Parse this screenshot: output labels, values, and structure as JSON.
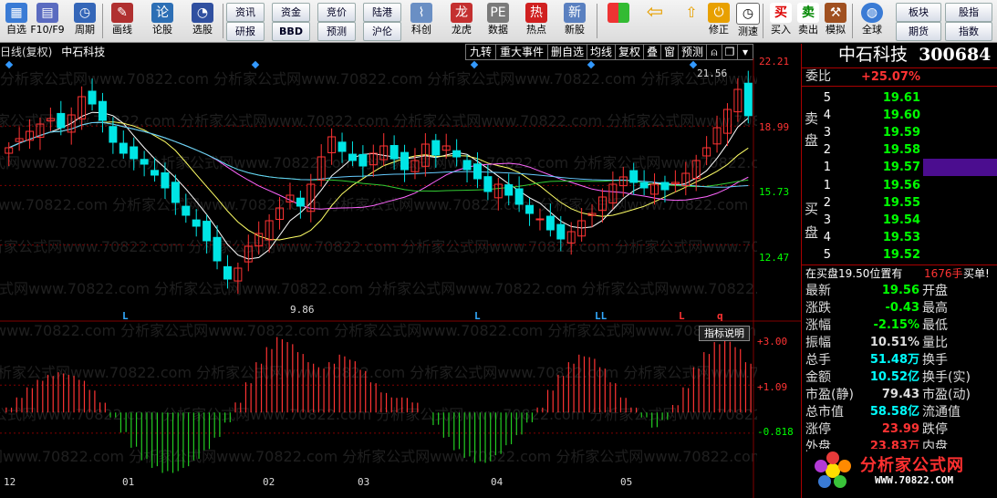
{
  "toolbar": {
    "groups": [
      {
        "label": "自选",
        "icon": "grid-icon",
        "color": "#3a7bd5"
      },
      {
        "label": "F10/F9",
        "icon": "doc-icon",
        "color": "#5a6bc0"
      },
      {
        "label": "周期",
        "icon": "clock-icon",
        "color": "#3466b8"
      },
      {
        "label": "画线",
        "icon": "pencil-icon",
        "color": "#b03030"
      },
      {
        "label": "论股",
        "icon": "chat-icon",
        "color": "#2d6fb5"
      },
      {
        "label": "选股",
        "icon": "gauge-icon",
        "color": "#3050a0"
      }
    ],
    "small_buttons_row1": [
      "资讯",
      "资金",
      "竞价",
      "陆港"
    ],
    "small_buttons_row2": [
      "研报",
      "BBD",
      "预测",
      "沪伦"
    ],
    "apps": [
      "科创",
      "龙虎",
      "数据",
      "热点",
      "新股"
    ],
    "right_buttons": [
      "修正",
      "测速",
      "买入",
      "卖出",
      "模拟",
      "全球"
    ],
    "right_small_row1": [
      "板块",
      "股指"
    ],
    "right_small_row2": [
      "期货",
      "指数"
    ]
  },
  "chart": {
    "title": "日线(复权)",
    "stock_name": "中石科技",
    "tabs": [
      "九转",
      "重大事件",
      "删自选",
      "均线",
      "复权",
      "叠",
      "窗",
      "预测"
    ],
    "price_ticks": [
      "22.21",
      "18.99",
      "15.73",
      "12.47"
    ],
    "high_marker": "21.56",
    "low_marker": "9.86",
    "indicator_button": "指标说明",
    "indicator_ticks": [
      "+3.00",
      "+1.09",
      "-0.818"
    ],
    "x_ticks": [
      "12",
      "01",
      "02",
      "03",
      "04",
      "05"
    ],
    "l_markers": [
      "L",
      "L",
      "LL",
      "L",
      "q"
    ]
  },
  "quote": {
    "name": "中石科技",
    "code": "300684",
    "weibi_label": "委比",
    "weibi_value": "+25.07%",
    "sell_label": [
      "卖",
      "盘"
    ],
    "buy_label": [
      "买",
      "盘"
    ],
    "asks": [
      {
        "level": "5",
        "price": "19.61"
      },
      {
        "level": "4",
        "price": "19.60"
      },
      {
        "level": "3",
        "price": "19.59"
      },
      {
        "level": "2",
        "price": "19.58"
      },
      {
        "level": "1",
        "price": "19.57"
      }
    ],
    "bids": [
      {
        "level": "1",
        "price": "19.56"
      },
      {
        "level": "2",
        "price": "19.55"
      },
      {
        "level": "3",
        "price": "19.54"
      },
      {
        "level": "4",
        "price": "19.53"
      },
      {
        "level": "5",
        "price": "19.52"
      }
    ],
    "notice_prefix": "在买盘19.50位置有",
    "notice_amount": "1676手",
    "notice_suffix": "买单!",
    "stats": [
      {
        "label": "最新",
        "value": "19.56",
        "label2": "开盘",
        "color": "#0f0"
      },
      {
        "label": "涨跌",
        "value": "-0.43",
        "label2": "最高",
        "color": "#0f0"
      },
      {
        "label": "涨幅",
        "value": "-2.15%",
        "label2": "最低",
        "color": "#0f0"
      },
      {
        "label": "振幅",
        "value": "10.51%",
        "label2": "量比",
        "color": "#ddd"
      },
      {
        "label": "总手",
        "value": "51.48万",
        "label2": "换手",
        "color": "#0ff"
      },
      {
        "label": "金额",
        "value": "10.52亿",
        "label2": "换手(实)",
        "color": "#0ff"
      },
      {
        "label": "市盈(静)",
        "value": "79.43",
        "label2": "市盈(动)",
        "color": "#ddd"
      },
      {
        "label": "总市值",
        "value": "58.58亿",
        "label2": "流通值",
        "color": "#0ff"
      },
      {
        "label": "涨停",
        "value": "23.99",
        "label2": "跌停",
        "color": "#f33"
      },
      {
        "label": "外盘",
        "value": "23.83万",
        "label2": "内盘",
        "color": "#f33"
      }
    ],
    "logo_text": "分析家公式网",
    "logo_url": "WWW.70822.COM"
  },
  "watermark": "分析家公式网www.70822.com",
  "colors": {
    "up": "#ff3333",
    "down": "#00e5e5",
    "grid": "#800000"
  },
  "chart_data": {
    "type": "line",
    "candles_close": [
      17.8,
      18.3,
      18.7,
      19.1,
      19.4,
      18.9,
      19.6,
      20.6,
      20.2,
      19.3,
      18.1,
      17.5,
      17.2,
      16.9,
      16.3,
      15.6,
      14.8,
      14.1,
      13.5,
      12.7,
      11.6,
      10.6,
      11.2,
      12.4,
      13.1,
      13.8,
      14.5,
      15.2,
      14.6,
      15.8,
      17.3,
      18.4,
      17.6,
      17.1,
      16.8,
      17.5,
      17.9,
      17.2,
      16.6,
      17.1,
      18.0,
      17.4,
      17.9,
      17.3,
      16.6,
      16.1,
      15.4,
      15.8,
      15.2,
      14.7,
      14.2,
      13.9,
      13.3,
      12.8,
      13.2,
      13.8,
      14.2,
      15.1,
      15.8,
      16.2,
      15.9,
      15.6,
      15.8,
      15.5,
      15.9,
      16.4,
      17.1,
      17.8,
      18.9,
      19.9,
      21.0,
      19.56
    ],
    "indicator": [
      0.2,
      0.6,
      1.0,
      1.3,
      1.5,
      1.6,
      1.5,
      1.3,
      0.9,
      0.4,
      -0.2,
      -0.8,
      -1.4,
      -1.9,
      -2.2,
      -2.4,
      -2.4,
      -2.2,
      -1.9,
      -1.5,
      -1.0,
      -0.4,
      0.4,
      1.2,
      2.0,
      2.6,
      3.0,
      2.8,
      2.4,
      2.0,
      1.8,
      2.0,
      2.3,
      2.1,
      1.7,
      1.2,
      0.8,
      0.6,
      0.6,
      0.4,
      0.0,
      -0.5,
      -1.0,
      -1.5,
      -1.8,
      -2.0,
      -2.0,
      -1.7,
      -1.3,
      -0.9,
      -0.4,
      0.2,
      0.9,
      1.5,
      2.0,
      2.3,
      2.2,
      1.8,
      1.2,
      0.6,
      0.2,
      -0.2,
      -0.6,
      -0.3,
      0.3,
      1.0,
      1.8,
      2.4,
      2.8,
      2.9,
      2.6,
      2.0
    ]
  }
}
